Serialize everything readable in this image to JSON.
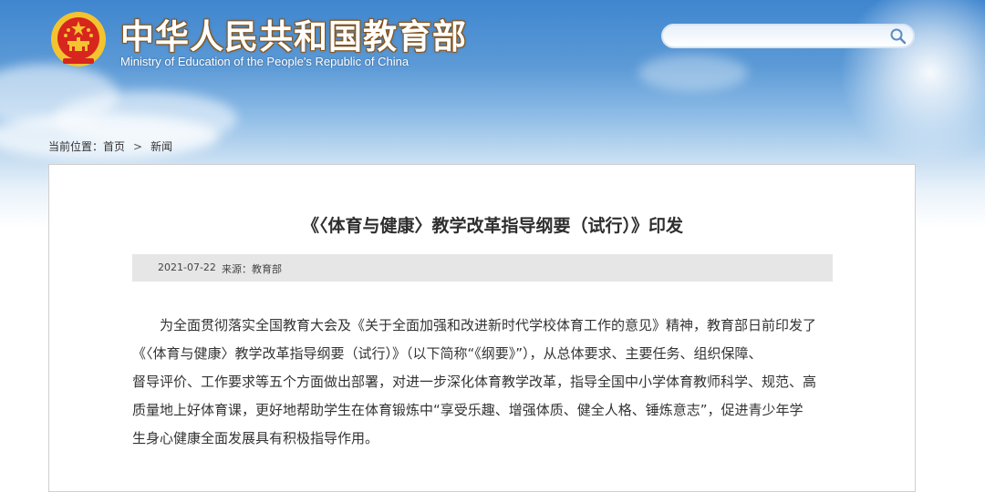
{
  "header": {
    "title": "中华人民共和国教育部",
    "subtitle": "Ministry of Education of the People's Republic of China"
  },
  "search": {
    "value": "",
    "placeholder": ""
  },
  "breadcrumb": {
    "prefix": "当前位置：",
    "home": "首页",
    "separator": ">",
    "current": "新闻"
  },
  "article": {
    "title": "《〈体育与健康〉教学改革指导纲要（试行）》印发",
    "date": "2021-07-22",
    "source": "来源：教育部",
    "lines": [
      "为全面贯彻落实全国教育大会及《关于全面加强和改进新时代学校体育工作的意见》精神，教育部日前印发了",
      "《〈体育与健康〉教学改革指导纲要（试行）》（以下简称“《纲要》”），从总体要求、主要任务、组织保障、",
      "督导评价、工作要求等五个方面做出部署，对进一步深化体育教学改革，指导全国中小学体育教师科学、规范、高",
      "质量地上好体育课，更好地帮助学生在体育锻炼中“享受乐趣、增强体质、健全人格、锤炼意志”，促进青少年学",
      "生身心健康全面发展具有积极指导作用。"
    ]
  },
  "colors": {
    "sky_top": "#3f86cf",
    "emblem_red": "#d7261e",
    "emblem_gold": "#f4c430",
    "meta_bar": "#e6e6e6"
  },
  "icons": [
    "national-emblem-icon",
    "search-icon"
  ]
}
